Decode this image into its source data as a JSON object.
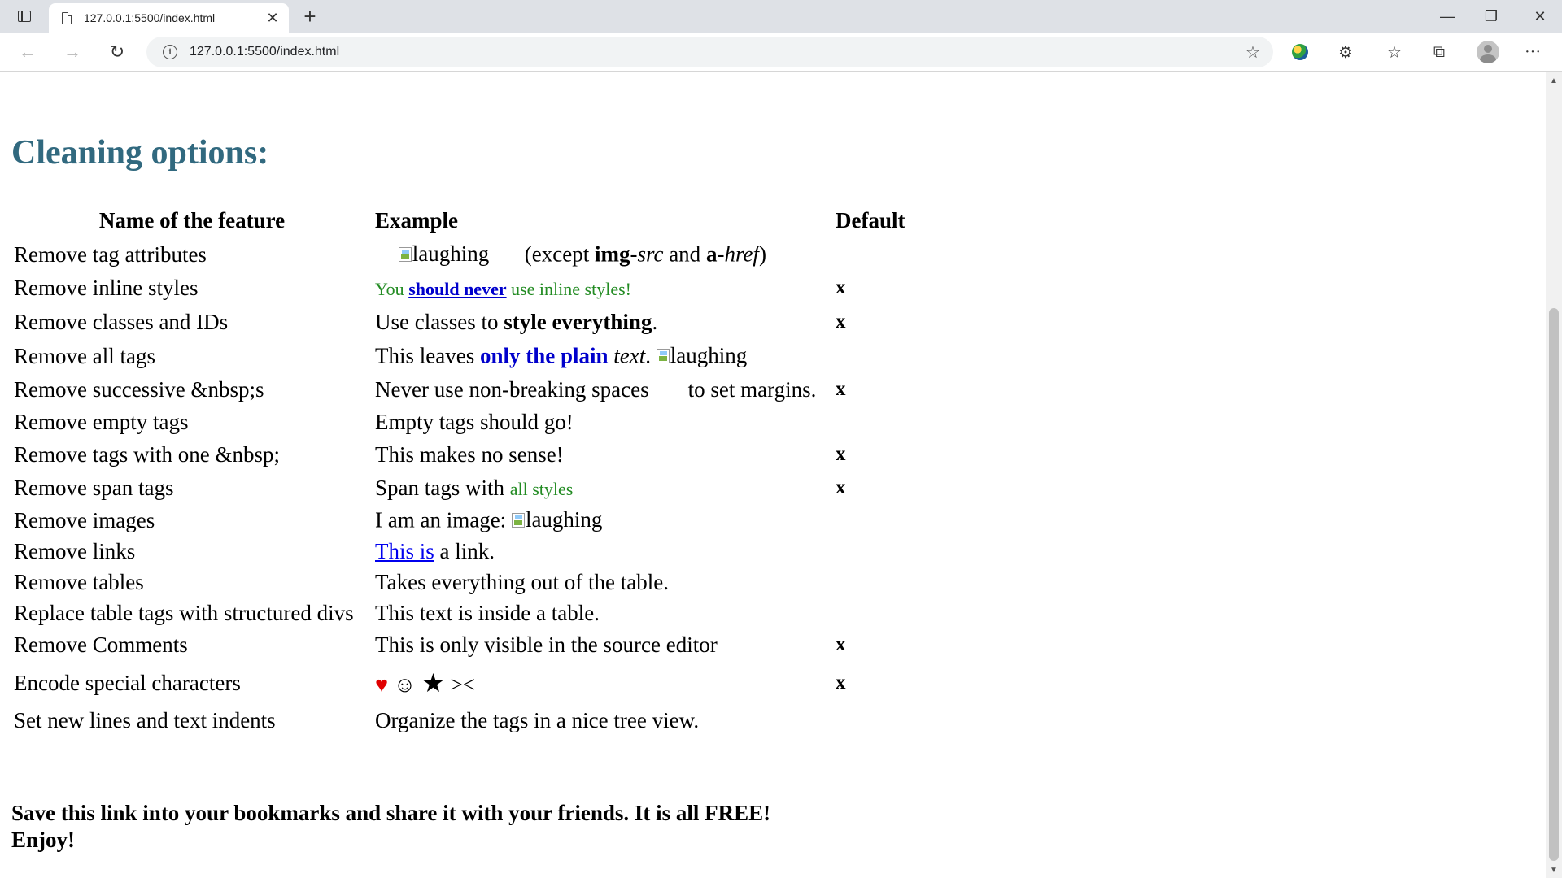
{
  "browser": {
    "tab_title": "127.0.0.1:5500/index.html",
    "url": "127.0.0.1:5500/index.html",
    "tab_close": "✕",
    "new_tab": "+",
    "minimize": "—",
    "restore": "❐",
    "close": "✕",
    "back": "←",
    "forward": "→",
    "reload": "↻",
    "favorites_add": "☆",
    "extensions": "⚙",
    "favorites": "☆",
    "collections": "⧉",
    "more": "···"
  },
  "page": {
    "title": "Cleaning options:",
    "table": {
      "headers": [
        "Name of the feature",
        "Example",
        "Default"
      ],
      "rows": [
        {
          "name": "Remove tag attributes",
          "default": ""
        },
        {
          "name": "Remove inline styles",
          "default": "x"
        },
        {
          "name": "Remove classes and IDs",
          "default": "x"
        },
        {
          "name": "Remove all tags",
          "default": ""
        },
        {
          "name": "Remove successive &nbsp;s",
          "default": "x"
        },
        {
          "name": "Remove empty tags",
          "default": ""
        },
        {
          "name": "Remove tags with one &nbsp;",
          "default": "x"
        },
        {
          "name": "Remove span tags",
          "default": "x"
        },
        {
          "name": "Remove images",
          "default": ""
        },
        {
          "name": "Remove links",
          "default": ""
        },
        {
          "name": "Remove tables",
          "default": ""
        },
        {
          "name": "Replace table tags with structured divs",
          "default": ""
        },
        {
          "name": "Remove Comments",
          "default": "x"
        },
        {
          "name": "Encode special characters",
          "default": "x"
        },
        {
          "name": "Set new lines and text indents",
          "default": ""
        }
      ],
      "examples": {
        "r0_img_alt": "laughing",
        "r0_except": "(except ",
        "r0_img": "img",
        "r0_dash1": "-",
        "r0_src": "src",
        "r0_and": " and ",
        "r0_a": "a",
        "r0_dash2": "-",
        "r0_href": "href",
        "r0_close": ")",
        "r1_you": "You ",
        "r1_should_never": "should never",
        "r1_rest": " use inline styles!",
        "r2_pre": "Use classes to ",
        "r2_bold": "style everything",
        "r2_post": ".",
        "r3_pre": "This leaves ",
        "r3_blue": "only the plain",
        "r3_italic": "text",
        "r3_dot": ".",
        "r3_img_alt": "laughing",
        "r4_a": "Never use non-breaking spaces",
        "r4_b": "to set margins.",
        "r5": "Empty tags should go!",
        "r6": "This makes no sense!",
        "r7_pre": "Span tags with ",
        "r7_green": "all styles",
        "r8_pre": "I am an image: ",
        "r8_img_alt": "laughing",
        "r9_link": "This is",
        "r9_rest": " a link.",
        "r10": "Takes everything out of the table.",
        "r11": "This text is inside a table.",
        "r12": "This is only visible in the source editor",
        "r13_heart": "♥",
        "r13_smile": "☺",
        "r13_star": "★",
        "r13_lg": "><",
        "r14": "Organize the tags in a nice tree view."
      }
    },
    "footer_line1": "Save this link into your bookmarks and share it with your friends. It is all FREE!",
    "footer_line2": "Enjoy!"
  }
}
